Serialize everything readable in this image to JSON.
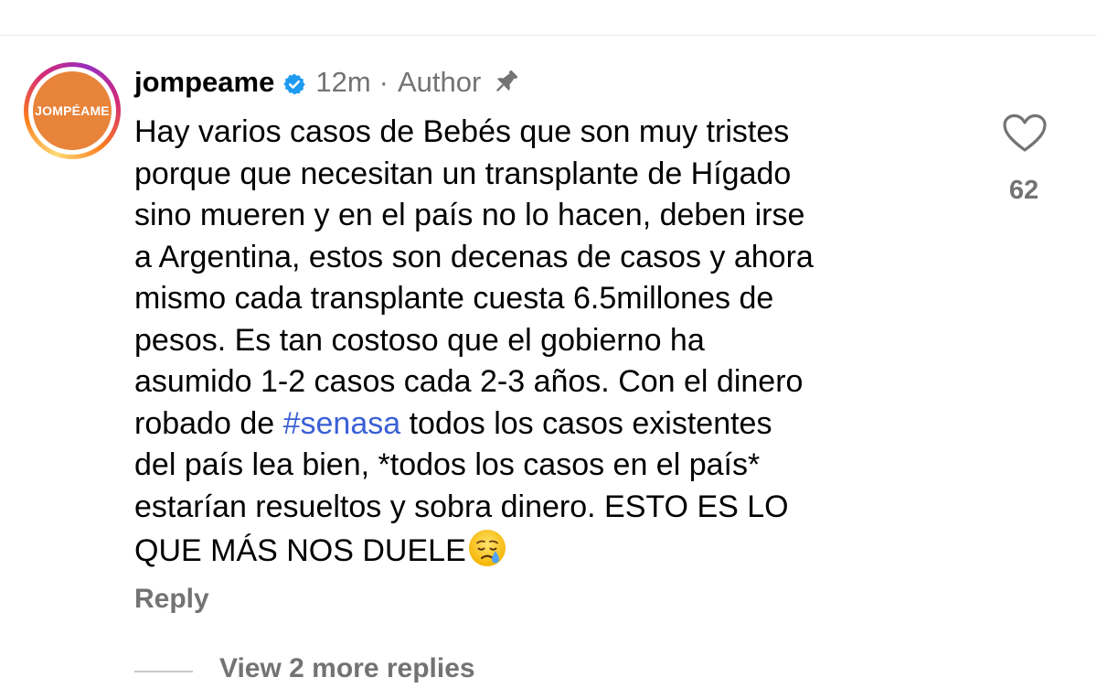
{
  "comment": {
    "avatar_text": "JOMPÉAME",
    "avatar_color": "#e8833a",
    "username": "jompeame",
    "timestamp": "12m",
    "separator": "·",
    "role": "Author",
    "lines": {
      "l1": "Hay varios casos de Bebés que son muy tristes",
      "l2": "porque que necesitan un transplante de Hígado",
      "l3": "sino mueren y en el país no lo hacen, deben irse",
      "l4": "a Argentina, estos son decenas de casos y ahora",
      "l5": "mismo cada transplante cuesta 6.5millones de",
      "l6": "pesos. Es tan costoso que el gobierno ha",
      "l7": "asumido 1-2 casos cada 2-3 años. Con el dinero",
      "l8_before": "robado de ",
      "l8_hashtag": "#senasa",
      "l8_after": " todos los casos existentes",
      "l9": "del país lea bien, *todos los casos en el país*",
      "l10": "estarían resueltos y sobra dinero. ESTO ES LO",
      "l11": "QUE MÁS NOS DUELE"
    },
    "emoji": "crying-face-icon",
    "like_count": "62",
    "reply_label": "Reply",
    "view_replies_label": "View 2 more replies"
  },
  "icons": {
    "verified": "verified-badge-icon",
    "pin": "pin-icon",
    "like": "heart-icon"
  },
  "colors": {
    "hashtag": "#3a5fd6",
    "verified": "#1d9bf0",
    "meta_text": "#737373"
  }
}
